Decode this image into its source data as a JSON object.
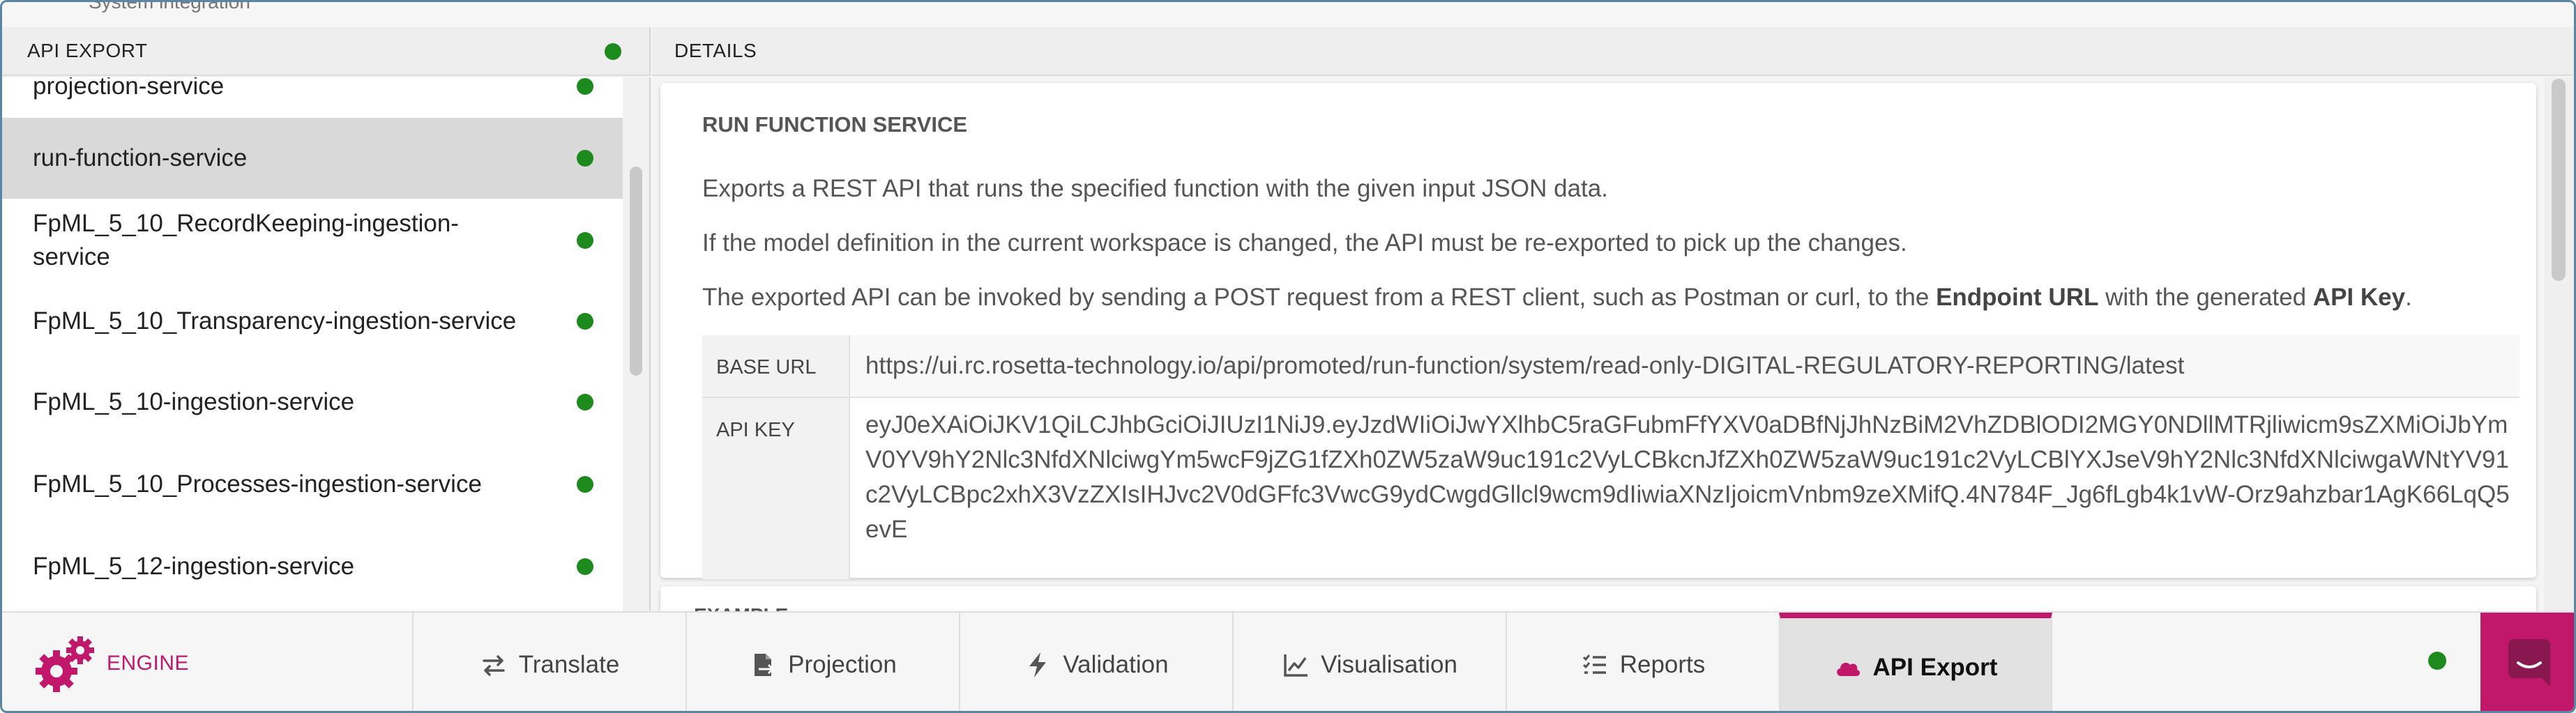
{
  "top": {
    "breadcrumb": "System integration"
  },
  "left_panel": {
    "header": "API EXPORT",
    "items": [
      {
        "label": "projection-service",
        "status_color": "#1d8a1d"
      },
      {
        "label": "run-function-service",
        "status_color": "#1d8a1d",
        "selected": true
      },
      {
        "label": "FpML_5_10_RecordKeeping-ingestion-service",
        "status_color": "#1d8a1d"
      },
      {
        "label": "FpML_5_10_Transparency-ingestion-service",
        "status_color": "#1d8a1d"
      },
      {
        "label": "FpML_5_10-ingestion-service",
        "status_color": "#1d8a1d"
      },
      {
        "label": "FpML_5_10_Processes-ingestion-service",
        "status_color": "#1d8a1d"
      },
      {
        "label": "FpML_5_12-ingestion-service",
        "status_color": "#1d8a1d"
      }
    ]
  },
  "details": {
    "header": "DETAILS",
    "title": "RUN FUNCTION SERVICE",
    "para1": "Exports a REST API that runs the specified function with the given input JSON data.",
    "para2": "If the model definition in the current workspace is changed, the API must be re-exported to pick up the changes.",
    "para3_before": "The exported API can be invoked by sending a POST request from a REST client, such as Postman or curl, to the ",
    "para3_bold1": "Endpoint URL",
    "para3_mid": " with the generated ",
    "para3_bold2": "API Key",
    "para3_end": ".",
    "base_url_label": "BASE URL",
    "base_url": "https://ui.rc.rosetta-technology.io/api/promoted/run-function/system/read-only-DIGITAL-REGULATORY-REPORTING/latest",
    "api_key_label": "API KEY",
    "api_key": "eyJ0eXAiOiJKV1QiLCJhbGciOiJIUzI1NiJ9.eyJzdWIiOiJwYXlhbC5raGFubmFfYXV0aDBfNjJhNzBiM2VhZDBlODI2MGY0NDllMTRjliwicm9sZXMiOiJbYmV0YV9hY2Nlc3NfdXNlciwgYm5wcF9jZG1fZXh0ZW5zaW9uc191c2VyLCBkcnJfZXh0ZW5zaW9uc191c2VyLCBlYXJseV9hY2Nlc3NfdXNlciwgaWNtYV91c2VyLCBpc2xhX3VzZXIsIHJvc2V0dGFfc3VwcG9ydCwgdGllcl9wcm9dIiwiaXNzIjoicmVnbm9zeXMifQ.4N784F_Jg6fLgb4k1vW-Orz9ahzbar1AgK66LqQ5evE",
    "next_card_peek": "EXAMPLE"
  },
  "bottom_bar": {
    "engine_label": "ENGINE",
    "accent": "#c2186c",
    "tabs": [
      {
        "label": "Translate",
        "icon": "translate-arrows-icon"
      },
      {
        "label": "Projection",
        "icon": "projection-doc-icon"
      },
      {
        "label": "Validation",
        "icon": "lightning-icon"
      },
      {
        "label": "Visualisation",
        "icon": "line-chart-icon"
      },
      {
        "label": "Reports",
        "icon": "checklist-icon"
      },
      {
        "label": "API Export",
        "icon": "cloud-icon",
        "active": true
      }
    ],
    "status_color": "#1d8a1d"
  }
}
